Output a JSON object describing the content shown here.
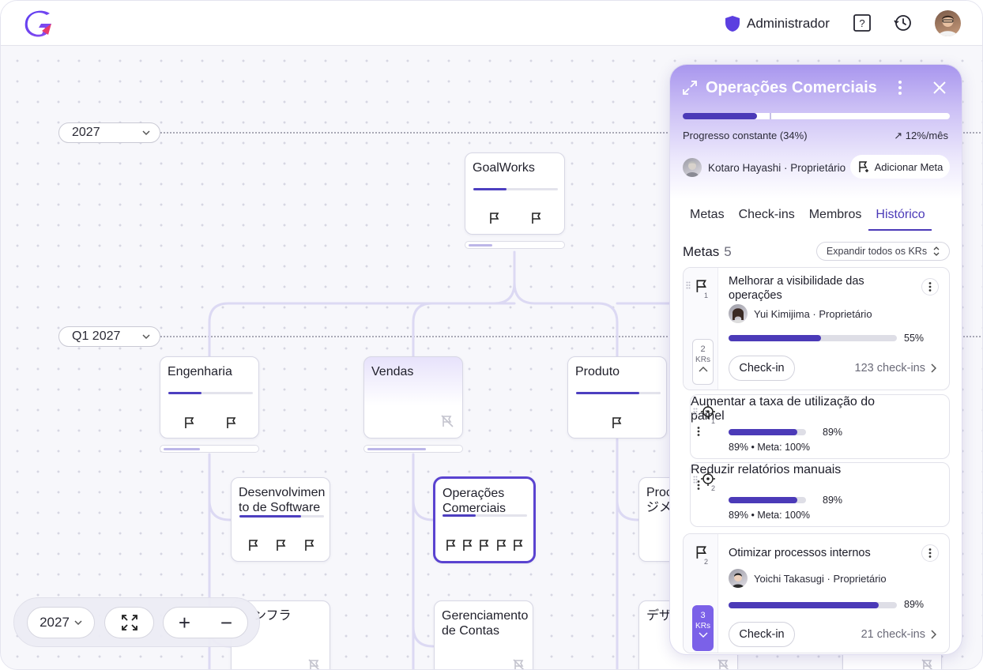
{
  "header": {
    "admin_label": "Administrador",
    "help_icon": "help-icon",
    "history_icon": "history-icon"
  },
  "canvas": {
    "year_select": "2027",
    "quarter_select": "Q1 2027",
    "nodes": {
      "root": "GoalWorks",
      "eng": "Engenharia",
      "sales": "Vendas",
      "product": "Produto",
      "dev": "Desenvolvimento de Software",
      "ops": "Operações Comerciais",
      "prod_partial": "Proc\nジメ",
      "infra_partial": "ンフラ",
      "accounts": "Gerenciamento de Contas",
      "design_partial": "デザ"
    }
  },
  "toolbar": {
    "year": "2027",
    "fit_icon": "fit-screen-icon",
    "zoom_in": "+",
    "zoom_out": "−"
  },
  "panel": {
    "title": "Operações Comerciais",
    "progress_value": 0.34,
    "status": "Progresso constante (34%)",
    "rate": "↗ 12%/mês",
    "owner": "Kotaro Hayashi · Proprietário",
    "add_goal": "Adicionar Meta",
    "tabs": [
      "Metas",
      "Check-ins",
      "Membros",
      "Histórico"
    ],
    "active_tab": "Histórico",
    "metas_label": "Metas",
    "metas_count": "5",
    "expand_label": "Expandir todos os KRs",
    "goals": [
      {
        "num": "1",
        "title": "Melhorar a visibilidade das operações",
        "owner": "Yui Kimijima · Proprietário",
        "progress": 0.55,
        "pct": "55%",
        "kr_count": "2",
        "kr_label": "KRs",
        "checkin": "Check-in",
        "checkins": "123 check-ins"
      },
      {
        "num": "2",
        "title": "Otimizar processos internos",
        "owner": "Yoichi Takasugi · Proprietário",
        "progress": 0.89,
        "pct": "89%",
        "kr_count": "3",
        "kr_label": "KRs",
        "checkin": "Check-in",
        "checkins": "21 check-ins"
      }
    ],
    "krs": [
      {
        "num": "1",
        "title": "Aumentar a taxa de utilização do painel",
        "progress": 0.89,
        "pct": "89%",
        "detail": "89% • Meta: 100%"
      },
      {
        "num": "2",
        "title": "Reduzir relatórios manuais",
        "progress": 0.89,
        "pct": "89%",
        "detail": "89% • Meta: 100%"
      }
    ]
  },
  "colors": {
    "accent": "#4b3ab8",
    "panel_gradient_top": "#a896ee",
    "kr_badge": "#7b61e8"
  }
}
